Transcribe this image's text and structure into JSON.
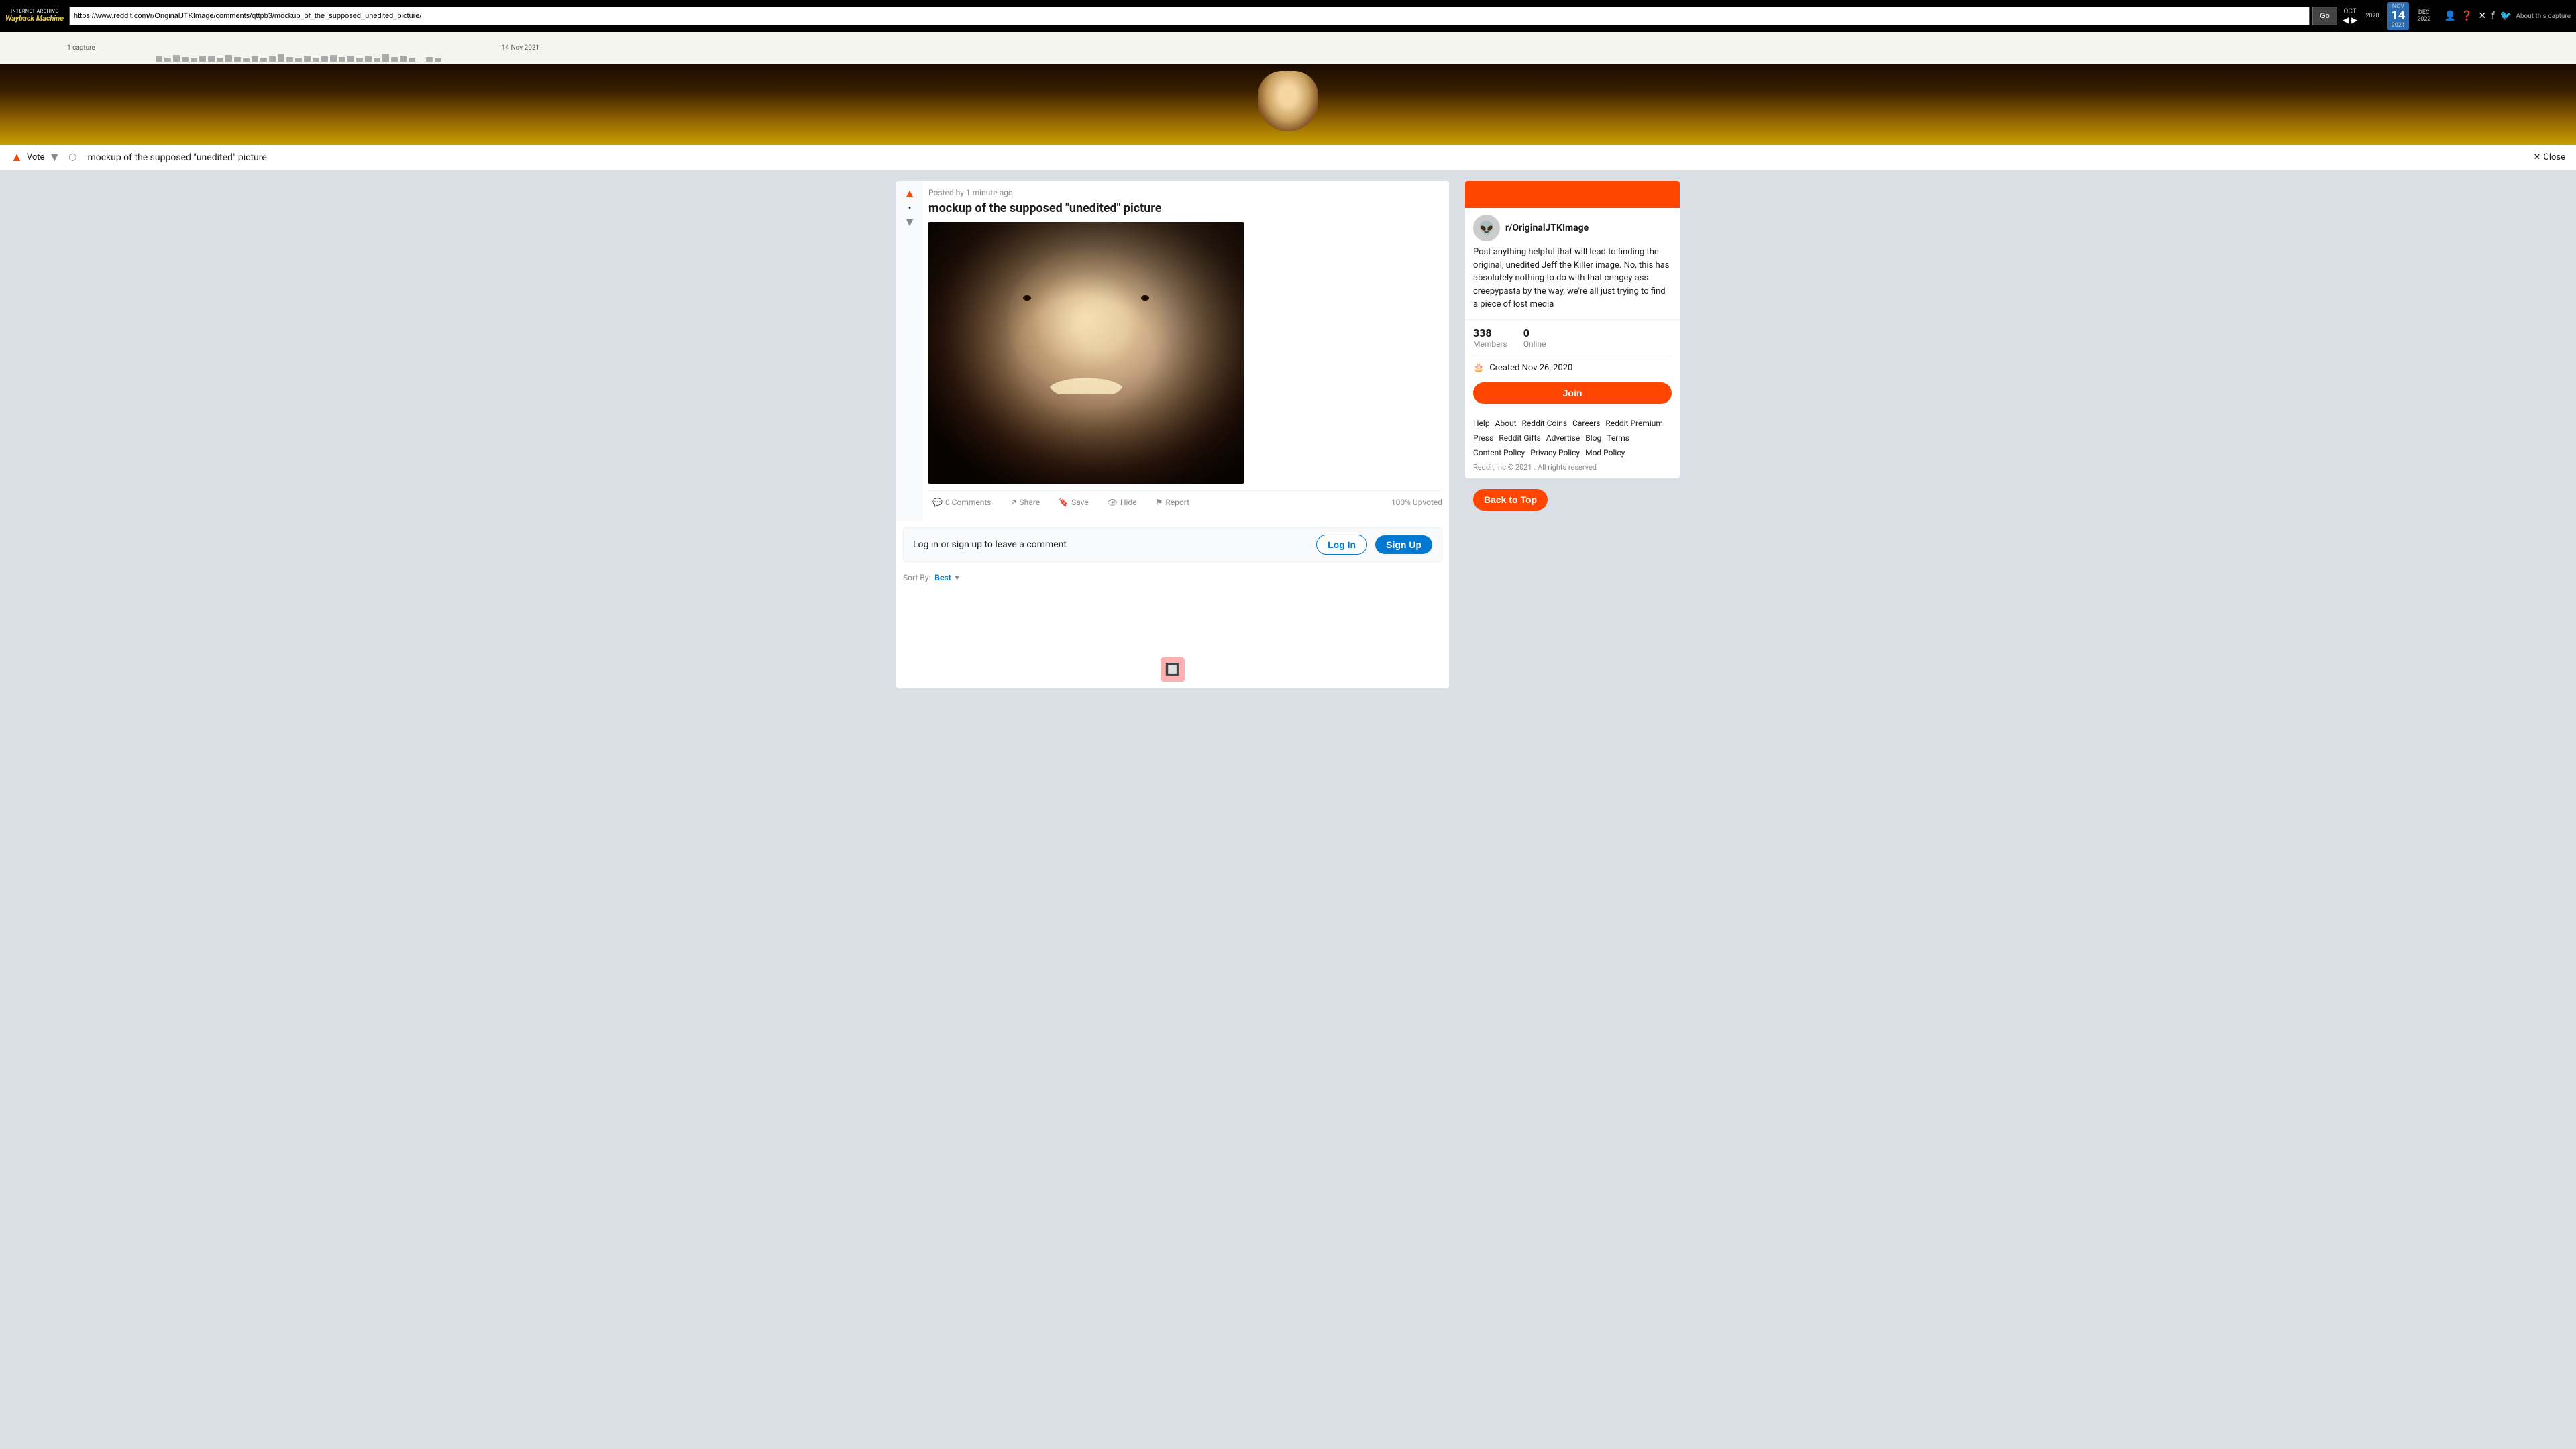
{
  "wayback": {
    "url": "https://www.reddit.com/r/OriginalJTKImage/comments/qttpb3/mockup_of_the_supposed_unedited_picture/",
    "go_label": "Go",
    "months": {
      "oct": "OCT",
      "nov": "NOV",
      "dec": "DEC"
    },
    "years": {
      "prev": "2020",
      "current": "2021",
      "next": "2022"
    },
    "day": "14",
    "capture_count": "1 capture",
    "capture_date": "14 Nov 2021",
    "about_label": "About this capture"
  },
  "title_bar": {
    "vote_label": "Vote",
    "post_title": "mockup of the supposed \"unedited\" picture",
    "close_label": "Close"
  },
  "post": {
    "meta": "Posted by 1 minute ago",
    "title": "mockup of the supposed \"unedited\" picture",
    "vote_label": "Vote",
    "actions": {
      "comments": "0 Comments",
      "share": "Share",
      "save": "Save",
      "hide": "Hide",
      "report": "Report"
    },
    "upvote_pct": "100% Upvoted"
  },
  "comment_section": {
    "login_prompt": "Log in or sign up to leave a comment",
    "login_btn": "Log In",
    "signup_btn": "Sign Up",
    "sort_label": "Sort By: Best"
  },
  "sidebar": {
    "subreddit_name": "r/OriginalJTKImage",
    "description": "Post anything helpful that will lead to finding the original, unedited Jeff the Killer image. No, this has absolutely nothing to do with that cringey ass creepypasta by the way, we're all just trying to find a piece of lost media",
    "stats": {
      "members_count": "338",
      "members_label": "Members",
      "online_count": "0",
      "online_label": "Online"
    },
    "created_label": "Created Nov 26, 2020",
    "join_btn": "Join",
    "footer": {
      "links": [
        "Help",
        "About",
        "Reddit Coins",
        "Careers",
        "Reddit Premium",
        "Press",
        "Reddit Gifts",
        "Advertise",
        "Blog",
        "Terms",
        "Content Policy",
        "Privacy Policy",
        "Mod Policy"
      ],
      "copyright": "Reddit Inc © 2021 . All rights reserved"
    },
    "back_to_top": "Back to Top"
  }
}
